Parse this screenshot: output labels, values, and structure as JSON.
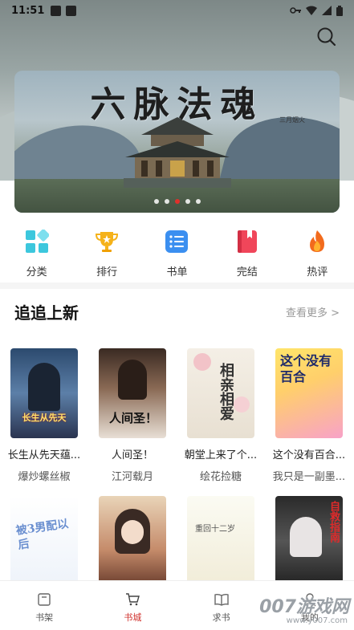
{
  "status_bar": {
    "time": "11:51"
  },
  "banner": {
    "title": "六脉法魂",
    "author_caption": "三月烟火",
    "dot_count": 5,
    "active_dot": 2
  },
  "categories": [
    {
      "label": "分类",
      "icon": "grid-icon",
      "color": "#3cc7dd"
    },
    {
      "label": "排行",
      "icon": "trophy-icon",
      "color": "#f5b21a"
    },
    {
      "label": "书单",
      "icon": "list-icon",
      "color": "#3b8ff0"
    },
    {
      "label": "完结",
      "icon": "bookmark-book-icon",
      "color": "#f0465a"
    },
    {
      "label": "热评",
      "icon": "flame-icon",
      "color": "#f26b1d"
    }
  ],
  "section": {
    "title": "追追上新",
    "more": "查看更多 >"
  },
  "books": [
    {
      "title": "长生从先天蕴...",
      "author": "爆炒螺丝椒",
      "cover_text": "长生从先天"
    },
    {
      "title": "人间圣！",
      "author": "江河载月",
      "cover_text": "人间圣！"
    },
    {
      "title": "朝堂上来了个...",
      "author": "绘花捡糖",
      "cover_text": "相亲相爱"
    },
    {
      "title": "这个没有百合...",
      "author": "我只是一副墨...",
      "cover_text": "这个没有百合"
    },
    {
      "title": "",
      "author": "",
      "cover_text": "被3男配以后"
    },
    {
      "title": "",
      "author": "",
      "cover_text": ""
    },
    {
      "title": "",
      "author": "",
      "cover_text": "重回十二岁"
    },
    {
      "title": "",
      "author": "",
      "cover_text": "自救指南"
    }
  ],
  "bottom_nav": [
    {
      "label": "书架",
      "icon": "bookshelf-icon",
      "active": false
    },
    {
      "label": "书城",
      "icon": "cart-icon",
      "active": true
    },
    {
      "label": "求书",
      "icon": "open-book-icon",
      "active": false
    },
    {
      "label": "我的",
      "icon": "profile-icon",
      "active": false
    }
  ],
  "watermark": {
    "text": "007游戏网",
    "url": "www.y007.com"
  },
  "colors": {
    "accent": "#d0312d",
    "active_dot": "#e0302b"
  }
}
